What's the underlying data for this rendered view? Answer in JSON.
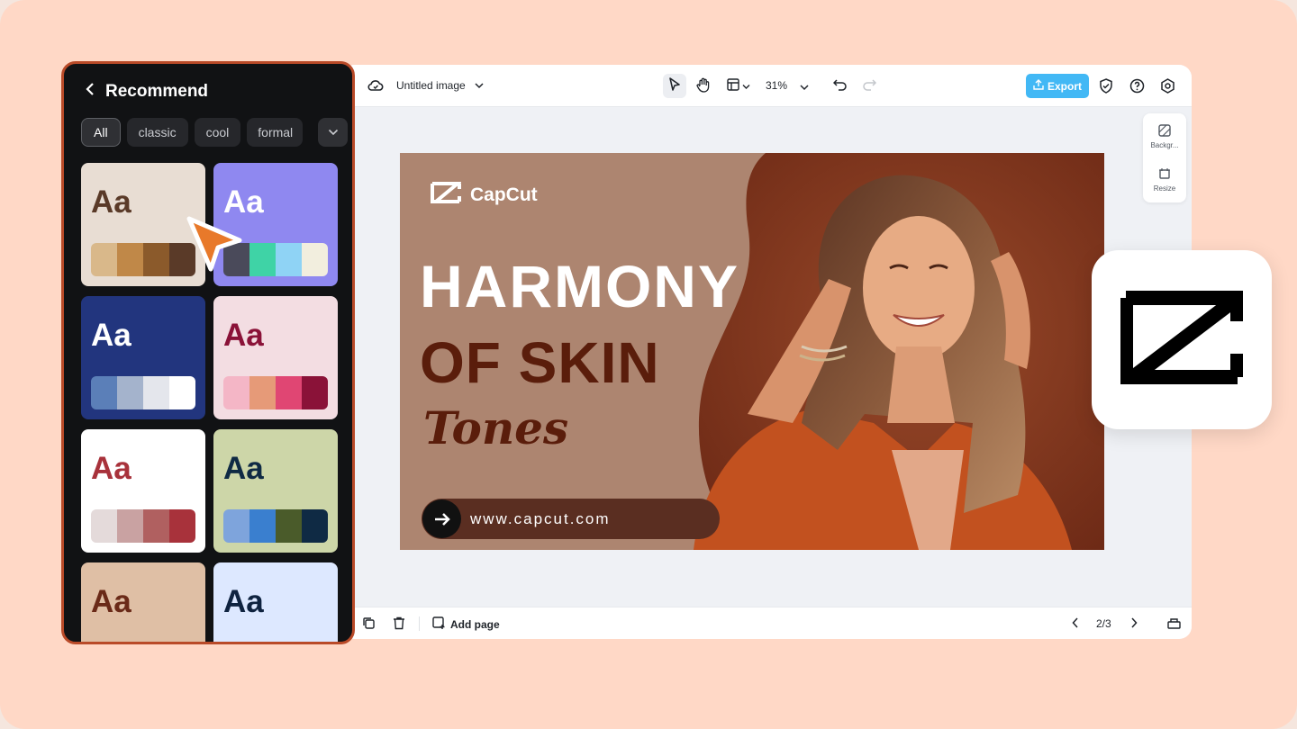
{
  "editor": {
    "doc_title": "Untitled image",
    "zoom": "31%",
    "export_label": "Export",
    "side_tools": [
      {
        "label": "Backgr...",
        "icon": "background-icon"
      },
      {
        "label": "Resize",
        "icon": "resize-icon"
      }
    ],
    "bottom": {
      "add_page_label": "Add page",
      "page_indicator": "2/3"
    }
  },
  "design": {
    "brand": "CapCut",
    "headline_line1": "HARMONY",
    "headline_line2": "OF SKIN",
    "headline_line3": "Tones",
    "url": "www.capcut.com"
  },
  "panel": {
    "title": "Recommend",
    "chips": [
      "All",
      "classic",
      "cool",
      "formal"
    ],
    "active_chip": "All",
    "palettes": [
      {
        "bg": "#e8ddd3",
        "text": "#5a3a28",
        "label": "Aa",
        "swatches": [
          "#d9b88a",
          "#c08848",
          "#8b5a2b",
          "#5a3a28"
        ]
      },
      {
        "bg": "#8f88f0",
        "text": "#ffffff",
        "label": "Aa",
        "swatches": [
          "#4a4a5a",
          "#3fd3a6",
          "#8fd3f5",
          "#f2eede"
        ]
      },
      {
        "bg": "#22357e",
        "text": "#ffffff",
        "label": "Aa",
        "swatches": [
          "#5b7fb8",
          "#a4b3cc",
          "#e4e6ec",
          "#ffffff"
        ]
      },
      {
        "bg": "#f3dde2",
        "text": "#8a1238",
        "label": "Aa",
        "swatches": [
          "#f4b6c6",
          "#e69a78",
          "#e04673",
          "#8a1238"
        ]
      },
      {
        "bg": "#ffffff",
        "text": "#a8323b",
        "label": "Aa",
        "swatches": [
          "#e4dada",
          "#c9a2a2",
          "#b06060",
          "#a8323b"
        ]
      },
      {
        "bg": "#cdd6a8",
        "text": "#0f2a44",
        "label": "Aa",
        "swatches": [
          "#7ea4dc",
          "#3a7fcf",
          "#4a5b2a",
          "#0f2a44"
        ]
      },
      {
        "bg": "#dfbfa5",
        "text": "#6a2a18",
        "label": "Aa",
        "swatches": []
      },
      {
        "bg": "#dde8ff",
        "text": "#0f2340",
        "label": "Aa",
        "swatches": []
      }
    ]
  },
  "colors": {
    "accent_export": "#42b8f5",
    "panel_border": "#b94a28",
    "background": "#ffd8c6",
    "cursor": "#e8792a"
  }
}
